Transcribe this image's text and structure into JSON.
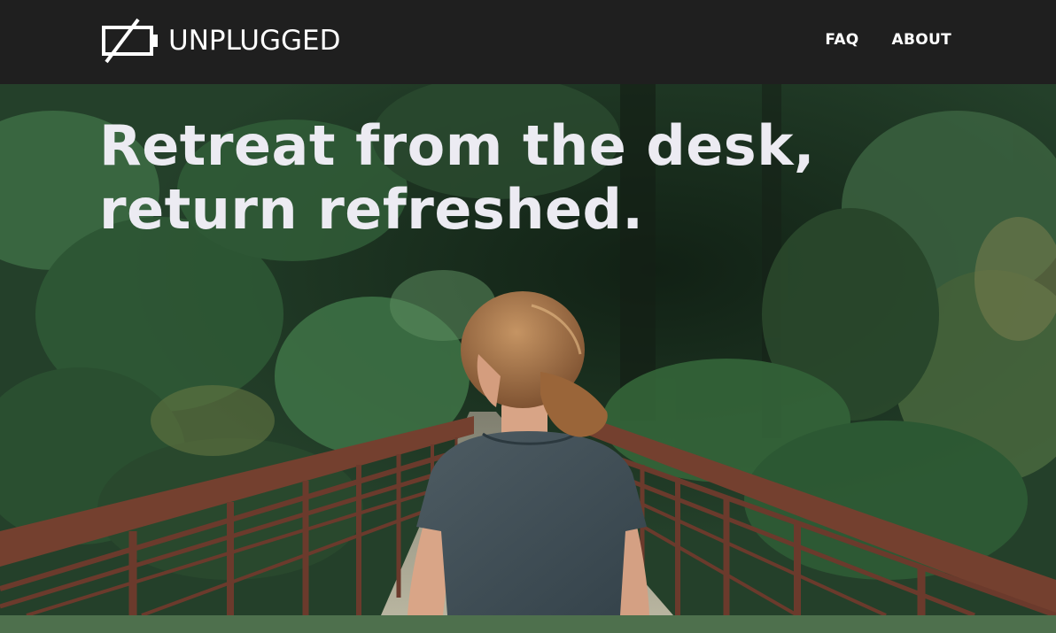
{
  "brand": {
    "name": "UNPLUGGED",
    "logo_icon": "unplugged-battery-icon"
  },
  "nav": {
    "items": [
      {
        "label": "FAQ"
      },
      {
        "label": "ABOUT"
      }
    ]
  },
  "hero": {
    "headline_line1": "Retreat from the desk,",
    "headline_line2": "return refreshed."
  },
  "colors": {
    "header_bg": "#1f1f1f",
    "headline_text": "#ecebf2",
    "bottom_band": "#4e704d",
    "railing": "#6b3a2c"
  }
}
